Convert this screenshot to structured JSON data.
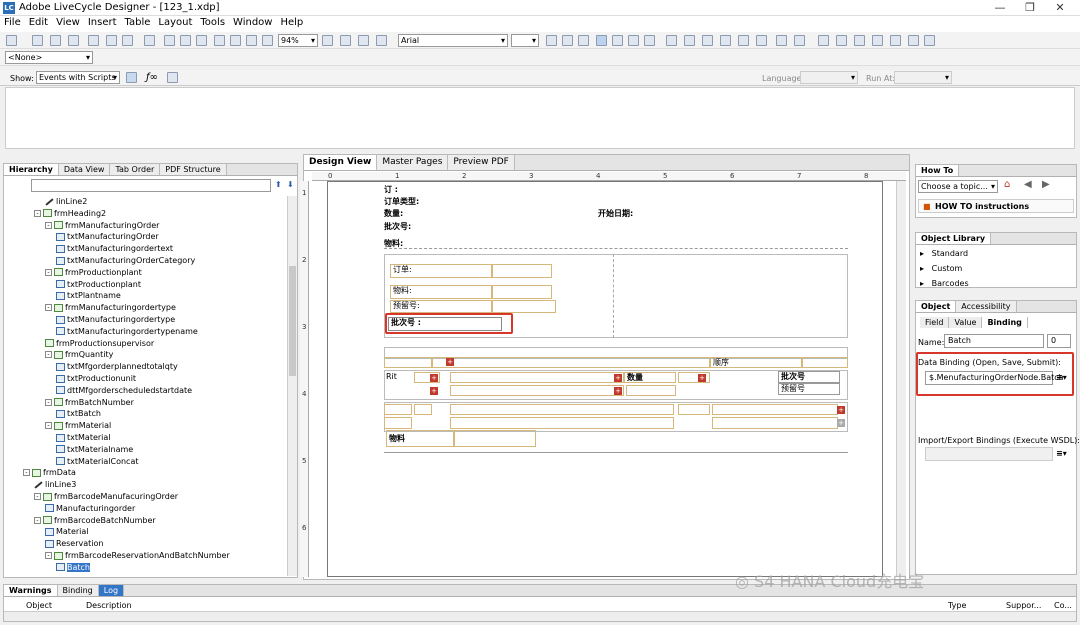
{
  "window": {
    "title": "Adobe LiveCycle Designer - [123_1.xdp]",
    "minimize": "—",
    "maximize": "❐",
    "close": "✕"
  },
  "menu": [
    "File",
    "Edit",
    "View",
    "Insert",
    "Table",
    "Layout",
    "Tools",
    "Window",
    "Help"
  ],
  "toolbar": {
    "zoom": "94%",
    "font": "Arial",
    "master_combo": "<None>"
  },
  "scriptbar": {
    "show_label": "Show:",
    "show_value": "Events with Scripts",
    "language_label": "Language:",
    "runat_label": "Run At:"
  },
  "hierarchy": {
    "tabs": [
      "Hierarchy",
      "Data View",
      "Tab Order",
      "PDF Structure"
    ],
    "rows": [
      {
        "label": "linLine2",
        "indent": 3,
        "icon": "line"
      },
      {
        "label": "frmHeading2",
        "indent": 2,
        "icon": "subform",
        "toggle": "-"
      },
      {
        "label": "frmManufacturingOrder",
        "indent": 3,
        "icon": "subform",
        "toggle": "-"
      },
      {
        "label": "txtManufacturingOrder",
        "indent": 4,
        "icon": "field"
      },
      {
        "label": "txtManufacturingordertext",
        "indent": 4,
        "icon": "field"
      },
      {
        "label": "txtManufacturingOrderCategory",
        "indent": 4,
        "icon": "field"
      },
      {
        "label": "frmProductionplant",
        "indent": 3,
        "icon": "subform",
        "toggle": "-"
      },
      {
        "label": "txtProductionplant",
        "indent": 4,
        "icon": "field"
      },
      {
        "label": "txtPlantname",
        "indent": 4,
        "icon": "field"
      },
      {
        "label": "frmManufacturingordertype",
        "indent": 3,
        "icon": "subform",
        "toggle": "-"
      },
      {
        "label": "txtManufacturingordertype",
        "indent": 4,
        "icon": "field"
      },
      {
        "label": "txtManufacturingordertypename",
        "indent": 4,
        "icon": "field"
      },
      {
        "label": "frmProductionsupervisor",
        "indent": 3,
        "icon": "subform"
      },
      {
        "label": "frmQuantity",
        "indent": 3,
        "icon": "subform",
        "toggle": "-"
      },
      {
        "label": "txtMfgorderplannedtotalqty",
        "indent": 4,
        "icon": "field"
      },
      {
        "label": "txtProductionunit",
        "indent": 4,
        "icon": "field"
      },
      {
        "label": "dttMfgorderscheduledstartdate",
        "indent": 4,
        "icon": "field"
      },
      {
        "label": "frmBatchNumber",
        "indent": 3,
        "icon": "subform",
        "toggle": "-"
      },
      {
        "label": "txtBatch",
        "indent": 4,
        "icon": "field"
      },
      {
        "label": "frmMaterial",
        "indent": 3,
        "icon": "subform",
        "toggle": "-"
      },
      {
        "label": "txtMaterial",
        "indent": 4,
        "icon": "field"
      },
      {
        "label": "txtMaterialname",
        "indent": 4,
        "icon": "field"
      },
      {
        "label": "txtMaterialConcat",
        "indent": 4,
        "icon": "field"
      },
      {
        "label": "frmData",
        "indent": 1,
        "icon": "subform",
        "toggle": "-"
      },
      {
        "label": "linLine3",
        "indent": 2,
        "icon": "line"
      },
      {
        "label": "frmBarcodeManufacuringOrder",
        "indent": 2,
        "icon": "subform",
        "toggle": "-"
      },
      {
        "label": "Manufacturingorder",
        "indent": 3,
        "icon": "field"
      },
      {
        "label": "frmBarcodeBatchNumber",
        "indent": 2,
        "icon": "subform",
        "toggle": "-"
      },
      {
        "label": "Material",
        "indent": 3,
        "icon": "field"
      },
      {
        "label": "Reservation",
        "indent": 3,
        "icon": "field"
      },
      {
        "label": "frmBarcodeReservationAndBatchNumber",
        "indent": 3,
        "icon": "subform",
        "toggle": "-"
      },
      {
        "label": "Batch",
        "indent": 4,
        "icon": "field",
        "selected": true
      }
    ]
  },
  "design": {
    "tabs": [
      "Design View",
      "Master Pages",
      "Preview PDF"
    ],
    "ruler_h": [
      "0",
      "1",
      "2",
      "3",
      "4",
      "5",
      "6",
      "7",
      "8"
    ],
    "ruler_v": [
      "1",
      "2",
      "3",
      "4",
      "5",
      "6"
    ],
    "header_labels": {
      "order": "订单类型:",
      "qty": "数量:",
      "batch": "批次号:",
      "material": "物料:",
      "start": "开始日期:",
      "top": "订 :"
    },
    "fields": {
      "order": "订单:",
      "material": "物料:",
      "reserve": "预留号:",
      "batch": "批次号 :",
      "seq": "顺序",
      "rit": "Rit",
      "qty": "数量",
      "batch2": "批次号",
      "reserve2": "预留号",
      "material2": "物料"
    }
  },
  "howto": {
    "tab": "How To",
    "topic": "Choose a topic...",
    "link": "HOW TO instructions",
    "link_prefix": "HOW TO"
  },
  "objlib": {
    "tab": "Object Library",
    "items": [
      "Standard",
      "Custom",
      "Barcodes"
    ]
  },
  "object": {
    "tabs": [
      "Object",
      "Accessibility"
    ],
    "subtabs": [
      "Field",
      "Value",
      "Binding"
    ],
    "name_label": "Name:",
    "name_value": "Batch",
    "name_index": "0",
    "binding_label": "Data Binding (Open, Save, Submit):",
    "binding_value": "$.MenufacturingOrderNode.Batch",
    "import_label": "Import/Export Bindings (Execute WSDL):"
  },
  "bottom": {
    "tabs": [
      "Warnings",
      "Binding",
      "Log"
    ],
    "columns": [
      "Object",
      "Description",
      "Type",
      "Suppor...",
      "Co..."
    ]
  },
  "watermark": "S4 HANA Cloud充电宝"
}
